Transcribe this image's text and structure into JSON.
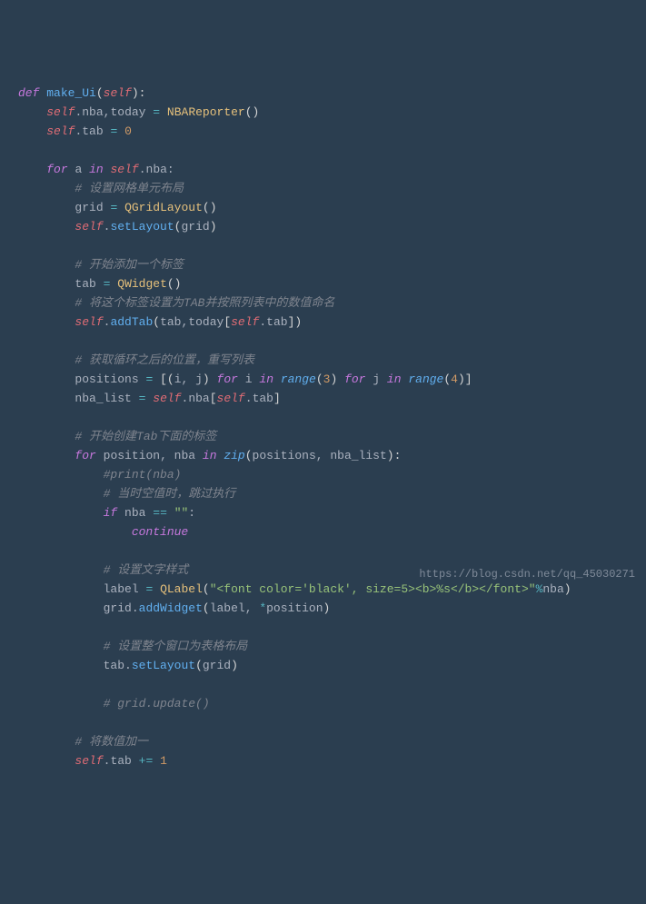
{
  "code": {
    "l1_def": "def",
    "l1_fn": "make_Ui",
    "l1_self": "self",
    "l2_self": "self",
    "l2_nba": "nba",
    "l2_today": "today",
    "l2_cls": "NBAReporter",
    "l3_self": "self",
    "l3_tab": "tab",
    "l3_zero": "0",
    "l5_for": "for",
    "l5_a": "a",
    "l5_in": "in",
    "l5_self": "self",
    "l5_nba": "nba",
    "l6_comment": "# 设置网格单元布局",
    "l7_grid": "grid",
    "l7_cls": "QGridLayout",
    "l8_self": "self",
    "l8_method": "setLayout",
    "l8_arg": "grid",
    "l10_comment": "# 开始添加一个标签",
    "l11_tab": "tab",
    "l11_cls": "QWidget",
    "l12_comment": "# 将这个标签设置为TAB并按照列表中的数值命名",
    "l13_self": "self",
    "l13_method": "addTab",
    "l13_arg1": "tab",
    "l13_arg2": "today",
    "l13_self2": "self",
    "l13_tab2": "tab",
    "l15_comment": "# 获取循环之后的位置，重写列表",
    "l16_positions": "positions",
    "l16_i": "i",
    "l16_j": "j",
    "l16_for1": "for",
    "l16_in1": "in",
    "l16_range1": "range",
    "l16_n3": "3",
    "l16_for2": "for",
    "l16_in2": "in",
    "l16_range2": "range",
    "l16_n4": "4",
    "l17_nbalist": "nba_list",
    "l17_self": "self",
    "l17_nba": "nba",
    "l17_self2": "self",
    "l17_tab": "tab",
    "l19_comment": "# 开始创建Tab下面的标签",
    "l20_for": "for",
    "l20_position": "position",
    "l20_nba": "nba",
    "l20_in": "in",
    "l20_zip": "zip",
    "l20_arg1": "positions",
    "l20_arg2": "nba_list",
    "l21_comment": "#print(nba)",
    "l22_comment": "# 当时空值时，跳过执行",
    "l23_if": "if",
    "l23_nba": "nba",
    "l23_eq": "==",
    "l23_empty": "\"\"",
    "l24_continue": "continue",
    "l26_comment": "# 设置文字样式",
    "l27_label": "label",
    "l27_cls": "QLabel",
    "l27_str": "\"<font color='black', size=5><b>%s</b></font>\"",
    "l27_pct": "%",
    "l27_nba": "nba",
    "l28_grid": "grid",
    "l28_method": "addWidget",
    "l28_arg1": "label",
    "l28_star": "*",
    "l28_arg2": "position",
    "l30_comment": "# 设置整个窗口为表格布局",
    "l31_tab": "tab",
    "l31_method": "setLayout",
    "l31_arg": "grid",
    "l33_comment": "# grid.update()",
    "l35_comment": "# 将数值加一",
    "l36_self": "self",
    "l36_tab": "tab",
    "l36_op": "+=",
    "l36_one": "1"
  },
  "watermark": "https://blog.csdn.net/qq_45030271"
}
